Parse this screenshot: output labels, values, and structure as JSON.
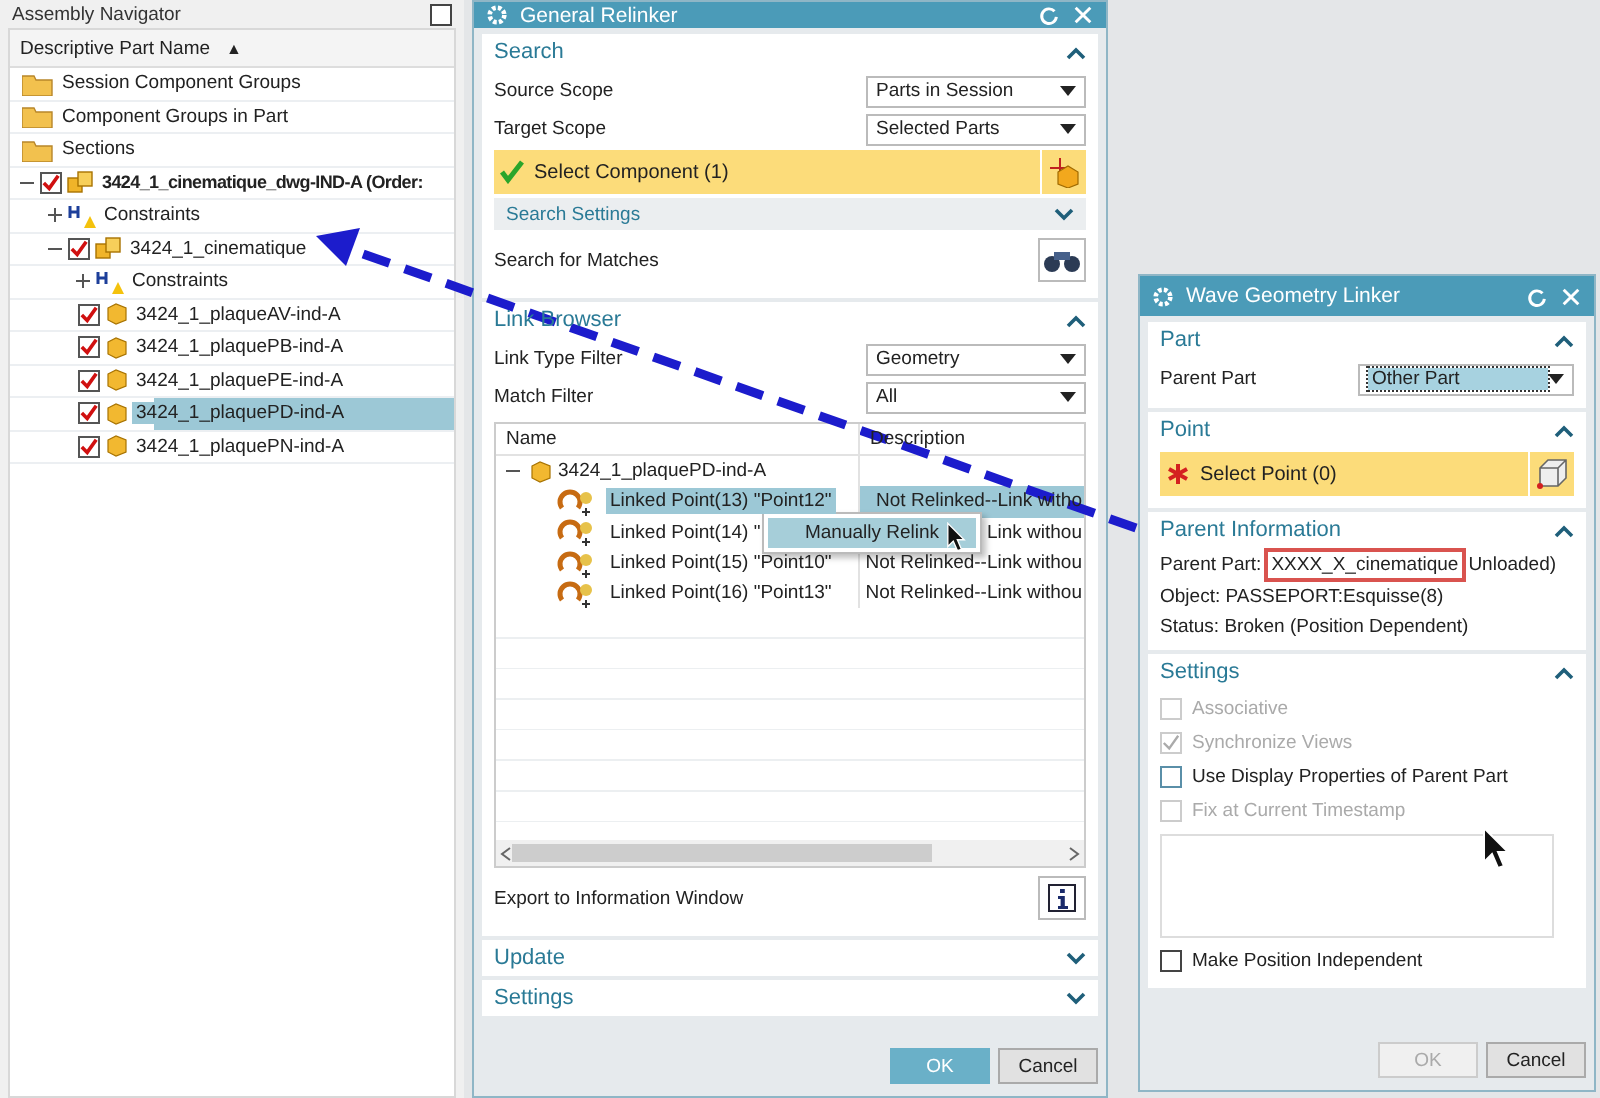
{
  "navigator": {
    "title": "Assembly Navigator",
    "column": "Descriptive Part Name",
    "sort_mark": "▲",
    "tree": [
      {
        "label": "Session Component Groups",
        "kind": "folder",
        "selected": false
      },
      {
        "label": "Component Groups in Part",
        "kind": "folder",
        "selected": false
      },
      {
        "label": "Sections",
        "kind": "folder",
        "selected": false
      },
      {
        "label": "3424_1_cinematique_dwg-IND-A (Order:",
        "kind": "assembly",
        "checked": true,
        "expanded": true,
        "selected": false,
        "children": [
          {
            "label": "Constraints",
            "kind": "constraints",
            "expanded": false,
            "selected": false
          },
          {
            "label": "3424_1_cinematique",
            "kind": "assembly",
            "checked": true,
            "expanded": true,
            "selected": false,
            "children": [
              {
                "label": "Constraints",
                "kind": "constraints",
                "expanded": false,
                "selected": false
              },
              {
                "label": "3424_1_plaqueAV-ind-A",
                "kind": "part",
                "checked": true,
                "selected": false
              },
              {
                "label": "3424_1_plaquePB-ind-A",
                "kind": "part",
                "checked": true,
                "selected": false
              },
              {
                "label": "3424_1_plaquePE-ind-A",
                "kind": "part",
                "checked": true,
                "selected": false
              },
              {
                "label": "3424_1_plaquePD-ind-A",
                "kind": "part",
                "checked": true,
                "selected": true
              },
              {
                "label": "3424_1_plaquePN-ind-A",
                "kind": "part",
                "checked": true,
                "selected": false
              }
            ]
          }
        ]
      }
    ]
  },
  "relinker": {
    "title": "General Relinker",
    "search": {
      "title": "Search",
      "expanded": true,
      "source_scope": {
        "label": "Source Scope",
        "value": "Parts in Session"
      },
      "target_scope": {
        "label": "Target Scope",
        "value": "Selected Parts"
      },
      "select_component": {
        "label": "Select Component (1)",
        "done": true
      },
      "search_settings": {
        "title": "Search Settings",
        "expanded": false
      },
      "search_matches": {
        "label": "Search for Matches"
      }
    },
    "link_browser": {
      "title": "Link Browser",
      "expanded": true,
      "link_type_filter": {
        "label": "Link Type Filter",
        "value": "Geometry"
      },
      "match_filter": {
        "label": "Match Filter",
        "value": "All"
      },
      "table": {
        "columns": [
          "Name",
          "Description"
        ],
        "rows": [
          {
            "name": "3424_1_plaquePD-ind-A",
            "kind": "part",
            "expanded": true,
            "children": [
              {
                "name": "Linked Point(13) \"Point12\"",
                "description": "Not Relinked--Link witho",
                "selected": true
              },
              {
                "name": "Linked Point(14) \"",
                "description": "Link withou",
                "selected": false
              },
              {
                "name": "Linked Point(15) \"Point10\"",
                "description": "Not Relinked--Link withou",
                "selected": false
              },
              {
                "name": "Linked Point(16) \"Point13\"",
                "description": "Not Relinked--Link withou",
                "selected": false
              }
            ]
          }
        ]
      },
      "export": {
        "label": "Export to Information Window"
      }
    },
    "update": {
      "title": "Update",
      "expanded": false
    },
    "settings": {
      "title": "Settings",
      "expanded": false
    },
    "buttons": [
      {
        "label": "OK",
        "kind": "primary"
      },
      {
        "label": "Cancel",
        "kind": "secondary"
      }
    ]
  },
  "context_menu": {
    "items": [
      {
        "label": "Manually Relink",
        "selected": true
      }
    ]
  },
  "wave": {
    "title": "Wave Geometry Linker",
    "part": {
      "title": "Part",
      "expanded": true,
      "parent_part": {
        "label": "Parent Part",
        "value": "Other Part"
      }
    },
    "point": {
      "title": "Point",
      "expanded": true,
      "select_point": {
        "label": "Select Point (0)",
        "done": false
      }
    },
    "parent_information": {
      "title": "Parent Information",
      "expanded": true,
      "parent_part_label": "Parent Part:",
      "parent_part_value": "XXXX_X_cinematique",
      "highlighted": true,
      "parent_part_note": "Unloaded)",
      "object": "Object: PASSEPORT:Esquisse(8)",
      "status": "Status: Broken (Position Dependent)"
    },
    "settings": {
      "title": "Settings",
      "expanded": true,
      "options": [
        {
          "label": "Associative",
          "checked": false,
          "disabled": true
        },
        {
          "label": "Synchronize Views",
          "checked": true,
          "disabled": true
        },
        {
          "label": "Use Display Properties of Parent Part",
          "checked": false,
          "disabled": false
        },
        {
          "label": "Fix at Current Timestamp",
          "checked": false,
          "disabled": true
        }
      ],
      "final_option": {
        "label": "Make Position Independent",
        "checked": false,
        "disabled": false
      }
    },
    "buttons": [
      {
        "label": "OK",
        "disabled": true
      },
      {
        "label": "Cancel",
        "disabled": false
      }
    ]
  }
}
